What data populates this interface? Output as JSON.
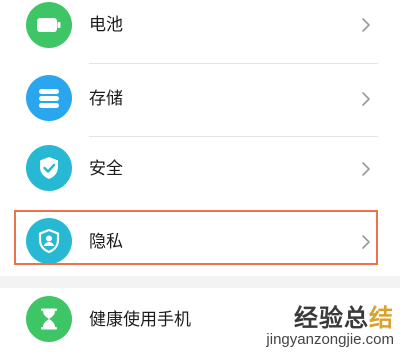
{
  "settings": {
    "items": [
      {
        "label": "电池",
        "icon": "battery-icon",
        "color": "#3ec565"
      },
      {
        "label": "存储",
        "icon": "storage-icon",
        "color": "#2aa6ef"
      },
      {
        "label": "安全",
        "icon": "shield-check-icon",
        "color": "#27b9d3"
      },
      {
        "label": "隐私",
        "icon": "privacy-icon",
        "color": "#27b9d3",
        "highlighted": true
      },
      {
        "label": "健康使用手机",
        "icon": "hourglass-icon",
        "color": "#3ec565"
      }
    ]
  },
  "highlight_color": "#e8734c",
  "watermark": {
    "text_main": "经验总",
    "text_accent": "结",
    "url": "jingyanzongjie.com"
  }
}
